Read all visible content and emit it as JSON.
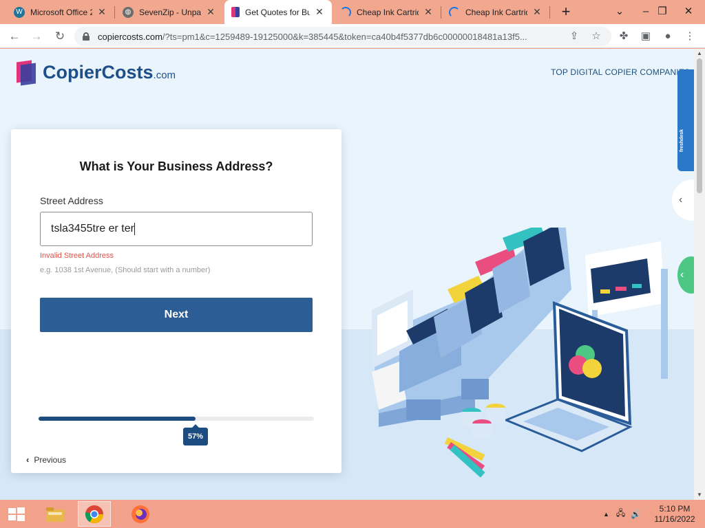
{
  "browser": {
    "tabs": [
      {
        "title": "Microsoft Office 2",
        "icon": "wordpress-icon",
        "active": false
      },
      {
        "title": "SevenZip - Unpac",
        "icon": "globe-icon",
        "active": false
      },
      {
        "title": "Get Quotes for Bu",
        "icon": "copiercosts-icon",
        "active": true
      },
      {
        "title": "Cheap Ink Cartrid",
        "icon": "loading-icon",
        "active": false
      },
      {
        "title": "Cheap Ink Cartrid",
        "icon": "loading-icon",
        "active": false
      }
    ],
    "new_tab_label": "+",
    "url_host": "copiercosts.com",
    "url_rest": "/?ts=pm1&c=1259489-19125000&k=385445&token=ca40b4f5377db6c00000018481a13f5..."
  },
  "page": {
    "logo_text": "CopierCosts",
    "logo_suffix": ".com",
    "top_nav": "TOP DIGITAL COPIER COMPANIES",
    "side_badge": "freshdesk",
    "form": {
      "heading": "What is Your Business Address?",
      "street_label": "Street Address",
      "street_value": "tsla3455tre er ter",
      "error": "Invalid Street Address",
      "hint": "e.g. 1038 1st Avenue, (Should start with a number)",
      "next_label": "Next",
      "progress_percent": 57,
      "progress_label": "57%",
      "previous_label": "Previous"
    }
  },
  "taskbar": {
    "time": "5:10 PM",
    "date": "11/16/2022"
  },
  "colors": {
    "brand_blue": "#2c5d95",
    "error_red": "#e0524a",
    "progress": "#1d4d80"
  }
}
